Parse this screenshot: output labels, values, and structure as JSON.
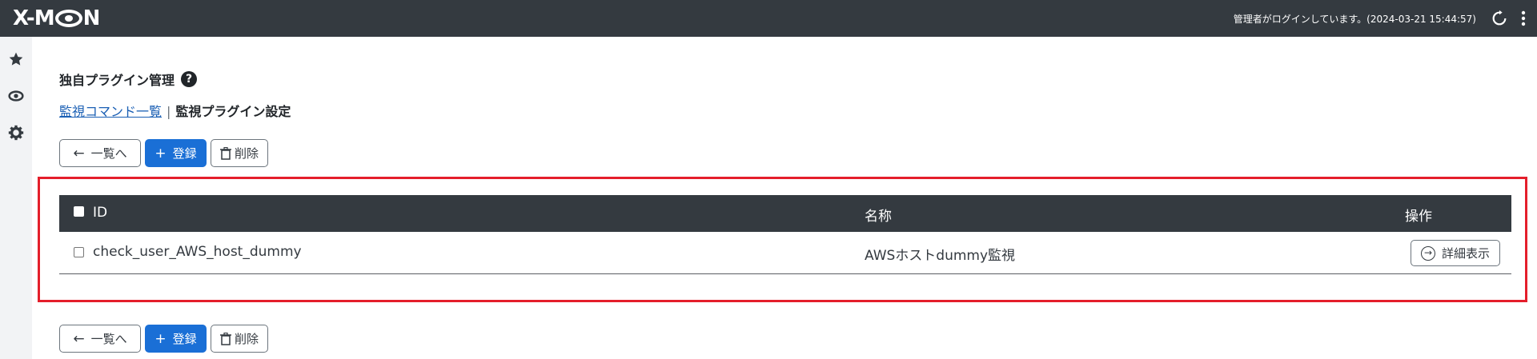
{
  "header": {
    "logo": "X-MON",
    "login_status": "管理者がログインしています。(2024-03-21 15:44:57)",
    "icons": {
      "reload": "reload-icon",
      "menu": "kebab-menu-icon"
    }
  },
  "sidebar": {
    "items": [
      {
        "icon": "star-icon"
      },
      {
        "icon": "eye-icon"
      },
      {
        "icon": "gear-icon"
      }
    ]
  },
  "page": {
    "title": "独自プラグイン管理",
    "help": "?",
    "subnav": {
      "link": "監視コマンド一覧",
      "separator": "|",
      "current": "監視プラグイン設定"
    }
  },
  "actions": {
    "back_label": "一覧へ",
    "register_label": "登録",
    "delete_label": "削除"
  },
  "table": {
    "columns": [
      "ID",
      "名称",
      "操作"
    ],
    "rows": [
      {
        "id": "check_user_AWS_host_dummy",
        "name": "AWSホストdummy監視",
        "action": "詳細表示"
      }
    ]
  },
  "colors": {
    "header_bg": "#343a40",
    "primary": "#1a6fd6",
    "highlight": "#e41e2b",
    "link": "#1a5fb4"
  }
}
